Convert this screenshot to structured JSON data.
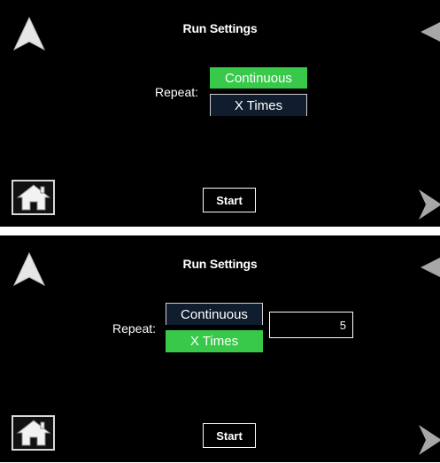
{
  "screens": [
    {
      "title": "Run Settings",
      "repeat_label": "Repeat:",
      "options": [
        "Continuous",
        "X Times"
      ],
      "selected": "Continuous",
      "start_label": "Start"
    },
    {
      "title": "Run Settings",
      "repeat_label": "Repeat:",
      "options": [
        "Continuous",
        "X Times"
      ],
      "selected": "X Times",
      "times_value": "5",
      "start_label": "Start"
    }
  ],
  "icons": {
    "up": "up-arrow-icon",
    "back": "left-arrow-icon",
    "next": "right-arrow-icon",
    "home": "home-icon"
  },
  "colors": {
    "selected": "#39c94a",
    "unselected": "#0f1d2e",
    "background": "#000000"
  }
}
